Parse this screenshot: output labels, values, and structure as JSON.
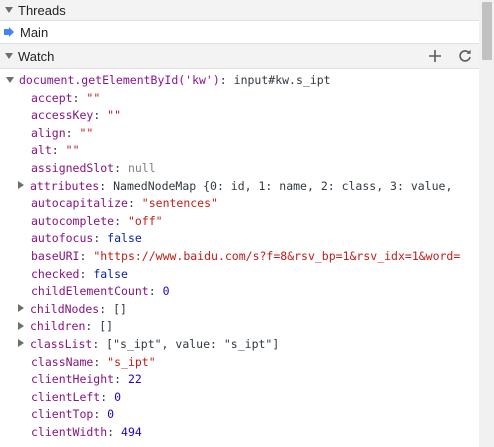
{
  "threads": {
    "title": "Threads",
    "items": [
      {
        "label": "Main"
      }
    ]
  },
  "watch": {
    "title": "Watch",
    "add_icon": "plus-icon",
    "refresh_icon": "refresh-icon",
    "expression": "document.getElementById('kw')",
    "expression_value": "input#kw.s_ipt",
    "properties": [
      {
        "name": "accept",
        "value": "\"\"",
        "kind": "str"
      },
      {
        "name": "accessKey",
        "value": "\"\"",
        "kind": "str"
      },
      {
        "name": "align",
        "value": "\"\"",
        "kind": "str"
      },
      {
        "name": "alt",
        "value": "\"\"",
        "kind": "str"
      },
      {
        "name": "assignedSlot",
        "value": "null",
        "kind": "nul"
      },
      {
        "name": "attributes",
        "value": "NamedNodeMap {0: id, 1: name, 2: class, 3: value,",
        "kind": "obj"
      },
      {
        "name": "autocapitalize",
        "value": "\"sentences\"",
        "kind": "str"
      },
      {
        "name": "autocomplete",
        "value": "\"off\"",
        "kind": "str"
      },
      {
        "name": "autofocus",
        "value": "false",
        "kind": "kw"
      },
      {
        "name": "baseURI",
        "value": "\"https://www.baidu.com/s?f=8&rsv_bp=1&rsv_idx=1&word=",
        "kind": "str"
      },
      {
        "name": "checked",
        "value": "false",
        "kind": "kw"
      },
      {
        "name": "childElementCount",
        "value": "0",
        "kind": "num"
      },
      {
        "name": "childNodes",
        "value": "[]",
        "kind": "obj"
      },
      {
        "name": "children",
        "value": "[]",
        "kind": "obj"
      },
      {
        "name": "classList",
        "value": "[\"s_ipt\", value: \"s_ipt\"]",
        "kind": "obj"
      },
      {
        "name": "className",
        "value": "\"s_ipt\"",
        "kind": "str"
      },
      {
        "name": "clientHeight",
        "value": "22",
        "kind": "num"
      },
      {
        "name": "clientLeft",
        "value": "0",
        "kind": "num"
      },
      {
        "name": "clientTop",
        "value": "0",
        "kind": "num"
      },
      {
        "name": "clientWidth",
        "value": "494",
        "kind": "num"
      }
    ]
  }
}
